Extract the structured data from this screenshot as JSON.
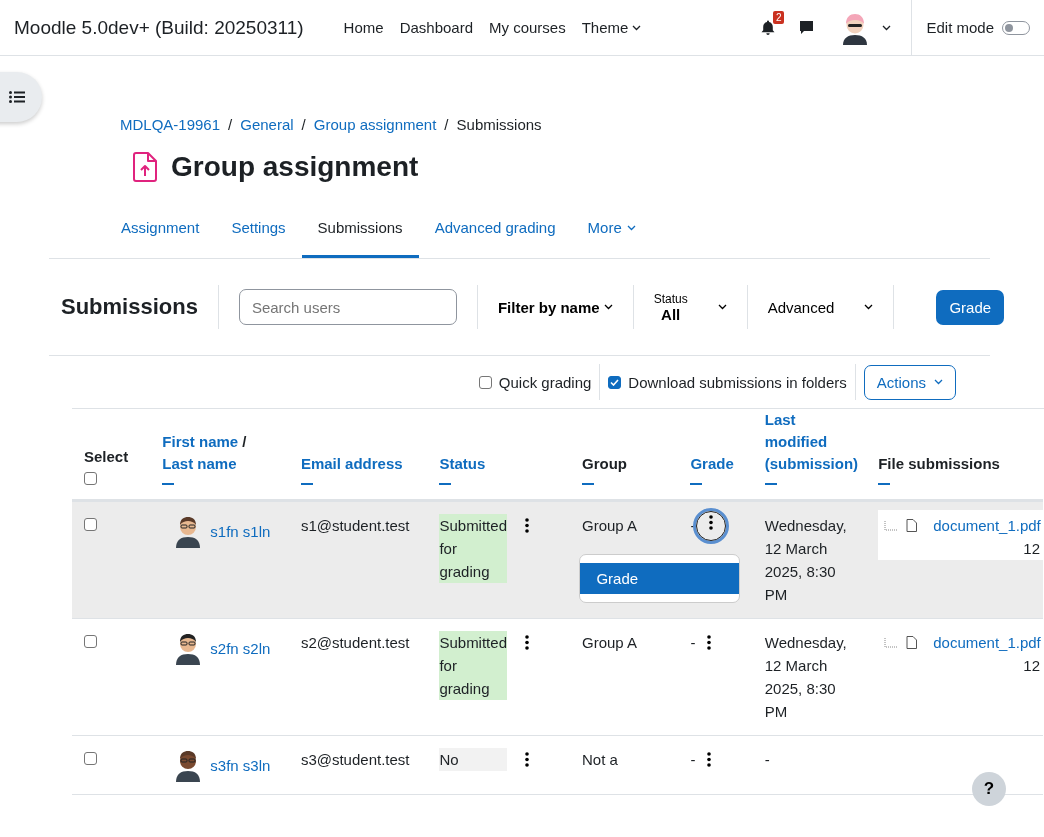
{
  "navbar": {
    "site_name": "Moodle 5.0dev+ (Build: 20250311)",
    "links": [
      {
        "label": "Home",
        "caret": false
      },
      {
        "label": "Dashboard",
        "caret": false
      },
      {
        "label": "My courses",
        "caret": false
      },
      {
        "label": "Theme",
        "caret": true
      }
    ],
    "notification_count": "2",
    "edit_mode": {
      "label": "Edit mode",
      "on": false
    }
  },
  "breadcrumb": [
    {
      "kind": "link",
      "label": "MDLQA-19961"
    },
    {
      "kind": "separator",
      "label": "/"
    },
    {
      "kind": "link",
      "label": "General"
    },
    {
      "kind": "separator",
      "label": "/"
    },
    {
      "kind": "link",
      "label": "Group assignment"
    },
    {
      "kind": "separator",
      "label": "/"
    },
    {
      "kind": "current",
      "label": "Submissions"
    }
  ],
  "title": "Group assignment",
  "tabs": [
    {
      "label": "Assignment",
      "selected": false,
      "caret": false
    },
    {
      "label": "Settings",
      "selected": false,
      "caret": false
    },
    {
      "label": "Submissions",
      "selected": true,
      "caret": false
    },
    {
      "label": "Advanced grading",
      "selected": false,
      "caret": false
    },
    {
      "label": "More",
      "selected": false,
      "caret": true
    }
  ],
  "toolbar": {
    "heading": "Submissions",
    "search": {
      "placeholder": "Search users"
    },
    "filter_by_name": "Filter by name",
    "status": {
      "label": "Status",
      "value": "All"
    },
    "advanced": "Advanced",
    "grade_button": "Grade"
  },
  "options": {
    "quick_grading": {
      "label": "Quick grading",
      "checked": false
    },
    "download_in_folders": {
      "label": "Download submissions in folders",
      "checked": true
    },
    "actions": "Actions"
  },
  "table": {
    "columns": [
      {
        "kind": "select",
        "label": "Select",
        "checked": false
      },
      {
        "kind": "name",
        "first": "First name",
        "separator": "/",
        "last": "Last name",
        "sortable": true
      },
      {
        "kind": "text",
        "label": "Email address",
        "sortable": true
      },
      {
        "kind": "text",
        "label": "Status",
        "sortable": true
      },
      {
        "kind": "text",
        "label": "Group",
        "sortable": false
      },
      {
        "kind": "text",
        "label": "Grade",
        "sortable": true
      },
      {
        "kind": "multi",
        "lines": [
          "Last",
          "modified",
          "(submission)"
        ],
        "sortable": true
      },
      {
        "kind": "text",
        "label": "File submissions",
        "sortable": false
      }
    ],
    "rows": [
      {
        "selected": false,
        "highlighted": true,
        "name": "s1fn s1ln",
        "email": "s1@student.test",
        "status": "Submitted for grading",
        "color": "#d2efcf",
        "group": "Group A",
        "grade": "-",
        "modified": "Wednesday, 12 March 2025, 8:30 PM",
        "file": "document_1.pdf",
        "file_extra": "12",
        "menu": [
          {
            "label": "Grade",
            "selected": true
          }
        ]
      },
      {
        "selected": false,
        "highlighted": false,
        "name": "s2fn s2ln",
        "email": "s2@student.test",
        "status": "Submitted for grading",
        "color": "#d2efcf",
        "group": "Group A",
        "grade": "-",
        "modified": "Wednesday, 12 March 2025, 8:30 PM",
        "file": "document_1.pdf",
        "file_extra": "12"
      },
      {
        "selected": false,
        "highlighted": false,
        "name": "s3fn s3ln",
        "email": "s3@student.test",
        "status": "No",
        "color": "#f2f2f2",
        "group": "Not a",
        "grade": "-",
        "modified": "-"
      }
    ]
  },
  "help_button": "?"
}
